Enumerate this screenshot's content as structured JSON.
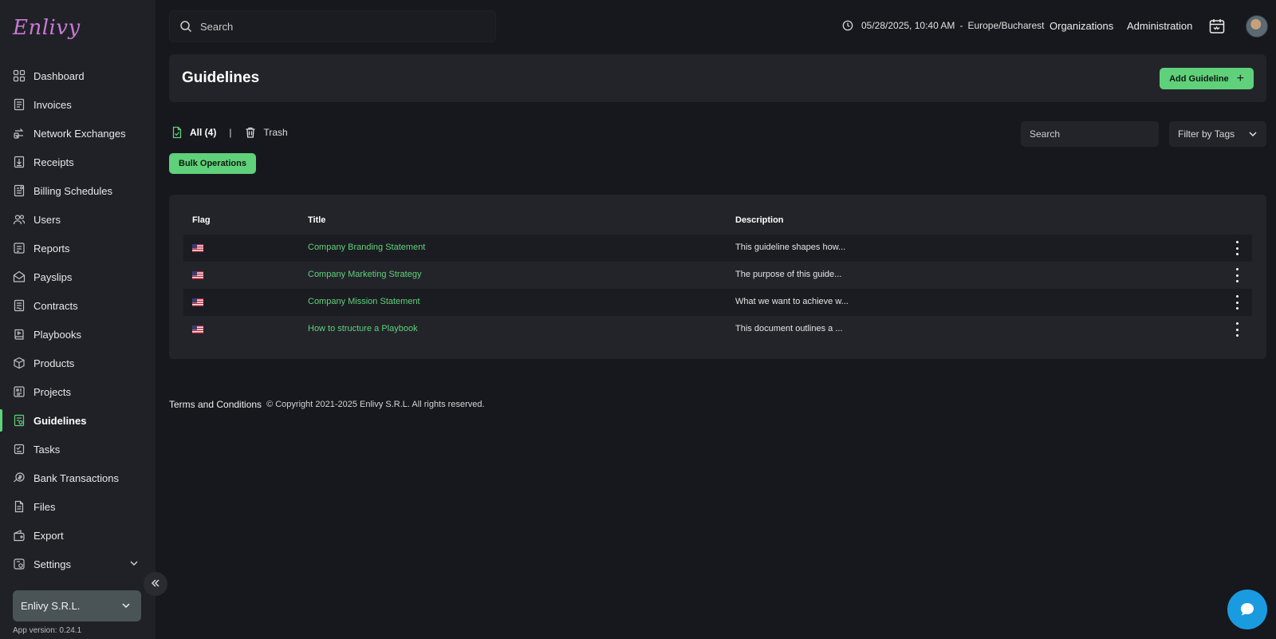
{
  "brand": {
    "logo_text": "Enlivy"
  },
  "sidebar": {
    "items": [
      {
        "label": "Dashboard",
        "icon": "dashboard-icon"
      },
      {
        "label": "Invoices",
        "icon": "invoice-icon"
      },
      {
        "label": "Network Exchanges",
        "icon": "exchange-icon"
      },
      {
        "label": "Receipts",
        "icon": "receipt-icon"
      },
      {
        "label": "Billing Schedules",
        "icon": "billing-schedule-icon"
      },
      {
        "label": "Users",
        "icon": "users-icon"
      },
      {
        "label": "Reports",
        "icon": "reports-icon"
      },
      {
        "label": "Payslips",
        "icon": "payslip-icon"
      },
      {
        "label": "Contracts",
        "icon": "contract-icon"
      },
      {
        "label": "Playbooks",
        "icon": "playbook-icon"
      },
      {
        "label": "Products",
        "icon": "product-icon"
      },
      {
        "label": "Projects",
        "icon": "project-icon"
      },
      {
        "label": "Guidelines",
        "icon": "guideline-icon",
        "active": true
      },
      {
        "label": "Tasks",
        "icon": "tasks-icon"
      },
      {
        "label": "Bank Transactions",
        "icon": "bank-icon"
      },
      {
        "label": "Files",
        "icon": "file-icon"
      },
      {
        "label": "Export",
        "icon": "export-icon"
      },
      {
        "label": "Settings",
        "icon": "settings-icon",
        "expandable": true
      }
    ],
    "organization": "Enlivy S.R.L.",
    "app_version": "App version: 0.24.1"
  },
  "topbar": {
    "search_placeholder": "Search",
    "datetime": "05/28/2025, 10:40 AM",
    "separator": "-",
    "timezone": "Europe/Bucharest",
    "organizations_label": "Organizations",
    "administration_label": "Administration"
  },
  "header": {
    "title": "Guidelines",
    "add_label": "Add Guideline"
  },
  "filters": {
    "all_label": "All (4)",
    "separator": "|",
    "trash_label": "Trash",
    "bulk_label": "Bulk Operations",
    "search_placeholder": "Search",
    "tags_label": "Filter by Tags"
  },
  "table": {
    "columns": [
      "Flag",
      "Title",
      "Description"
    ],
    "rows": [
      {
        "flag": "us-flag-icon",
        "title": "Company Branding Statement",
        "description": "This guideline shapes how..."
      },
      {
        "flag": "us-flag-icon",
        "title": "Company Marketing Strategy",
        "description": "The purpose of this guide..."
      },
      {
        "flag": "us-flag-icon",
        "title": "Company Mission Statement",
        "description": "What we want to achieve w..."
      },
      {
        "flag": "us-flag-icon",
        "title": "How to structure a Playbook",
        "description": "This document outlines a ..."
      }
    ]
  },
  "footer": {
    "terms_label": "Terms and Conditions",
    "copyright": "© Copyright 2021-2025 Enlivy S.R.L. All rights reserved."
  },
  "colors": {
    "accent": "#5fd17a",
    "background": "#17181d",
    "sidebar": "#202127",
    "panel": "#23242a",
    "chat": "#1a9be0"
  }
}
